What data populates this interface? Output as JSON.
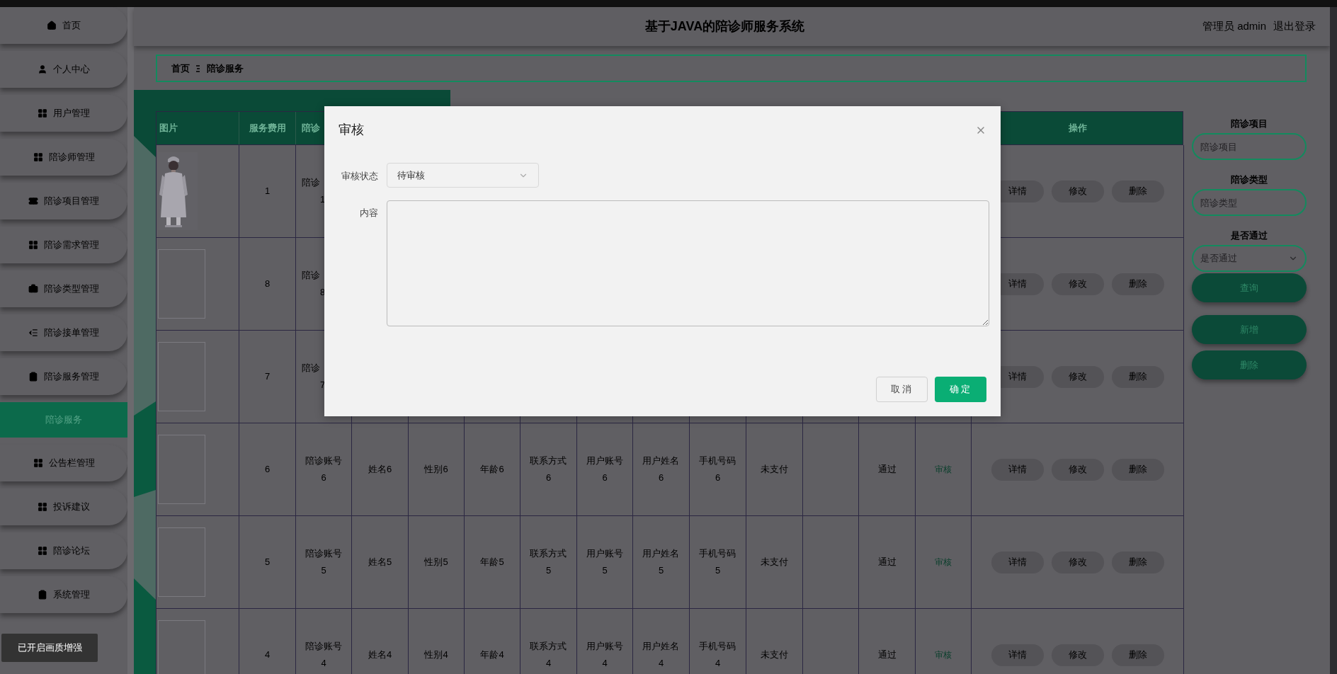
{
  "top_bar": {
    "title": "基于JAVA的陪诊师服务系统",
    "user": "管理员 admin",
    "logout": "退出登录"
  },
  "sidebar": {
    "items": [
      {
        "label": "首页",
        "selected": false
      },
      {
        "label": "个人中心",
        "selected": false
      },
      {
        "label": "用户管理",
        "selected": false
      },
      {
        "label": "陪诊师管理",
        "selected": false
      },
      {
        "label": "陪诊项目管理",
        "selected": false
      },
      {
        "label": "陪诊需求管理",
        "selected": false
      },
      {
        "label": "陪诊类型管理",
        "selected": false
      },
      {
        "label": "陪诊接单管理",
        "selected": false
      },
      {
        "label": "陪诊服务管理",
        "selected": false
      },
      {
        "label": "陪诊服务",
        "selected": true
      },
      {
        "label": "公告栏管理",
        "selected": false
      },
      {
        "label": "投诉建议",
        "selected": false
      },
      {
        "label": "陪诊论坛",
        "selected": false
      },
      {
        "label": "系统管理",
        "selected": false
      }
    ]
  },
  "breadcrumb": [
    "首页",
    "陪诊服务"
  ],
  "table": {
    "columns": [
      "图片",
      "服务费用",
      "陪诊"
    ],
    "action_column": "操作",
    "rows": [
      {
        "kind": "covered",
        "image": {
          "kind": "picture"
        },
        "fee": "1",
        "account_lines": [
          "陪诊",
          "1"
        ],
        "actions": [
          "详情",
          "修改",
          "删除"
        ]
      },
      {
        "kind": "covered",
        "fee": "8",
        "account_lines": [
          "陪诊",
          "8"
        ],
        "actions": [
          "详情",
          "修改",
          "删除"
        ]
      },
      {
        "kind": "covered",
        "fee": "7",
        "account_lines": [
          "陪诊",
          "7"
        ],
        "actions": [
          "详情",
          "修改",
          "删除"
        ]
      },
      {
        "kind": "full",
        "fee": "6",
        "account": "陪诊账号6",
        "name": "姓名6",
        "gender": "性别6",
        "age": "年龄6",
        "contact": "联系方式6",
        "user_account": "用户账号6",
        "user_name": "用户姓名6",
        "phone": "手机号码6",
        "payment": "未支付",
        "approval": "通过",
        "review": "审核",
        "actions": [
          "详情",
          "修改",
          "删除"
        ]
      },
      {
        "kind": "full",
        "fee": "5",
        "account": "陪诊账号5",
        "name": "姓名5",
        "gender": "性别5",
        "age": "年龄5",
        "contact": "联系方式5",
        "user_account": "用户账号5",
        "user_name": "用户姓名5",
        "phone": "手机号码5",
        "payment": "未支付",
        "approval": "通过",
        "review": "审核",
        "actions": [
          "详情",
          "修改",
          "删除"
        ]
      },
      {
        "kind": "full",
        "fee": "4",
        "account": "陪诊账号4",
        "name": "姓名4",
        "gender": "性别4",
        "age": "年龄4",
        "contact": "联系方式4",
        "user_account": "用户账号4",
        "user_name": "用户姓名4",
        "phone": "手机号码4",
        "payment": "未支付",
        "approval": "通过",
        "review": "审核",
        "actions": [
          "详情",
          "修改",
          "删除"
        ]
      }
    ]
  },
  "search_panel": {
    "fields": [
      {
        "kind": "input",
        "label": "陪诊项目",
        "placeholder": "陪诊项目"
      },
      {
        "kind": "input",
        "label": "陪诊类型",
        "placeholder": "陪诊类型"
      },
      {
        "kind": "select",
        "label": "是否通过",
        "placeholder": "是否通过"
      }
    ],
    "query_button": "查询",
    "buttons": [
      "新增",
      "删除"
    ]
  },
  "dialog": {
    "title": "审核",
    "fields": [
      {
        "kind": "select",
        "label": "审核状态",
        "value": "待审核"
      },
      {
        "kind": "textarea",
        "label": "内容"
      }
    ],
    "buttons": [
      {
        "label": "取消",
        "kind": "secondary"
      },
      {
        "label": "确定",
        "kind": "primary"
      }
    ]
  },
  "toast": "已开启画质增强"
}
